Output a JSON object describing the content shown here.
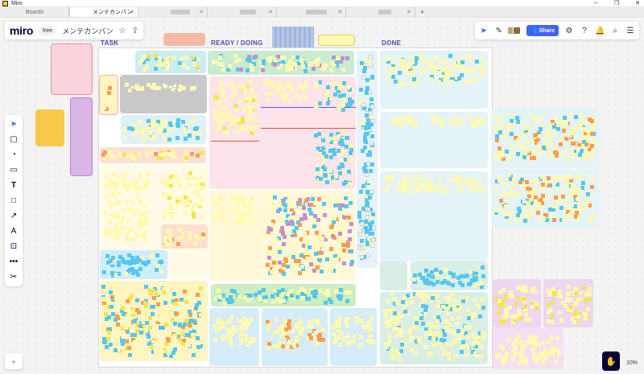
{
  "window": {
    "title": "Miro"
  },
  "tabs": [
    {
      "label": "Boards",
      "active": false
    },
    {
      "label": "メンテカンバン",
      "active": true
    },
    {
      "label": "",
      "active": false
    },
    {
      "label": "",
      "active": false
    },
    {
      "label": "",
      "active": false
    },
    {
      "label": "",
      "active": false
    }
  ],
  "header": {
    "logo": "miro",
    "plan": "free",
    "board_name": "メンテカンバン"
  },
  "toolbar": {
    "share_label": "Share"
  },
  "columns": {
    "task": "TASK",
    "ready_doing": "READY / DOING",
    "done": "DONE"
  },
  "zoom": {
    "level": "10%"
  },
  "colors": {
    "accent": "#4262ff",
    "sticky_yellow": "#fff9b1",
    "sticky_blue": "#56c6f0",
    "sticky_orange": "#ff9d48",
    "frame_blue": "#dff1f7",
    "frame_pink": "#fde3ea",
    "frame_green": "#e0f3ea",
    "frame_purple": "#ecd6f0",
    "frame_yellow": "#fff8d9"
  },
  "icons": {
    "window": [
      "minimize-icon",
      "maximize-icon",
      "close-icon"
    ],
    "header": [
      "star-icon",
      "upload-icon"
    ],
    "top_right": [
      "cursor-icon",
      "magic-icon",
      "settings-sliders-icon",
      "help-icon",
      "bell-icon",
      "search-icon",
      "panel-icon"
    ],
    "left_tools": [
      "select-icon",
      "sticky-note-icon",
      "template-icon",
      "comment-icon",
      "text-icon",
      "shape-icon",
      "connector-icon",
      "pen-icon",
      "frame-icon",
      "more-icon",
      "integrations-icon"
    ]
  }
}
